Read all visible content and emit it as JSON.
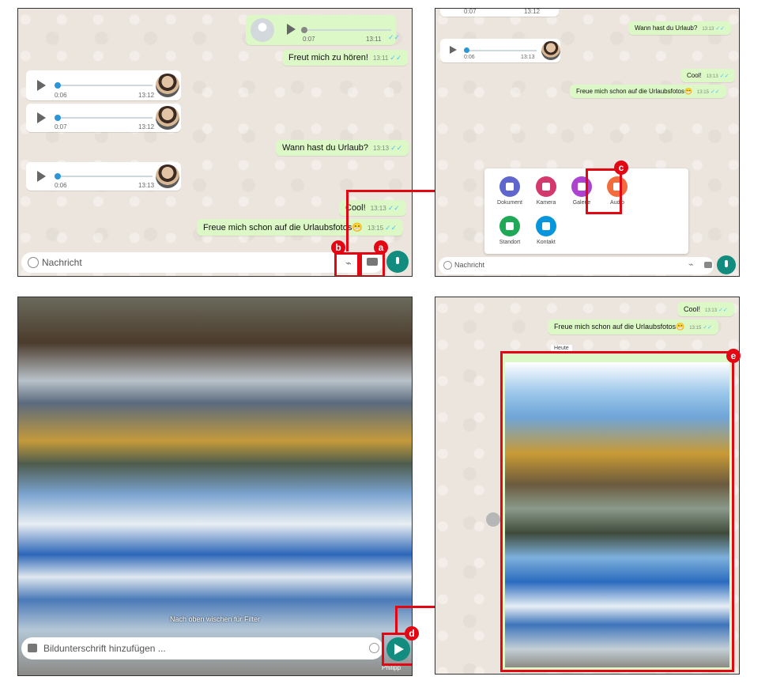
{
  "panel1": {
    "voice_out": {
      "elapsed": "0:07",
      "time": "13:11"
    },
    "msg_hoeren": {
      "text": "Freut mich zu hören!",
      "time": "13:11"
    },
    "voice_in": [
      {
        "elapsed": "0:06",
        "time": "13:12"
      },
      {
        "elapsed": "0:07",
        "time": "13:12"
      },
      {
        "elapsed": "0:06",
        "time": "13:13"
      }
    ],
    "msg_urlaub": {
      "text": "Wann hast du Urlaub?",
      "time": "13:13"
    },
    "msg_cool": {
      "text": "Cool!",
      "time": "13:13"
    },
    "msg_fotos": {
      "text": "Freue mich schon auf die Urlaubsfotos😁",
      "time": "13:15"
    },
    "input_placeholder": "Nachricht",
    "badge_b": "b",
    "badge_a": "a"
  },
  "panel2": {
    "top_times": [
      "0:07",
      "13:12"
    ],
    "msg_urlaub": {
      "text": "Wann hast du Urlaub?",
      "time": "13:13"
    },
    "voice_in": {
      "elapsed": "0:06",
      "time": "13:13"
    },
    "msg_cool": {
      "text": "Cool!",
      "time": "13:13"
    },
    "msg_fotos": {
      "text": "Freue mich schon auf die Urlaubsfotos😁",
      "time": "13:15"
    },
    "attach_menu": [
      {
        "label": "Dokument",
        "color": "#5f66cd"
      },
      {
        "label": "Kamera",
        "color": "#d3396d"
      },
      {
        "label": "Galerie",
        "color": "#ac44cf"
      },
      {
        "label": "Audio",
        "color": "#f26d3d"
      },
      {
        "label": "Standort",
        "color": "#1fa855"
      },
      {
        "label": "Kontakt",
        "color": "#0795dc"
      }
    ],
    "input_placeholder": "Nachricht",
    "badge_c": "c"
  },
  "panel3": {
    "swipe_hint": "Nach oben wischen für Filter",
    "caption_placeholder": "Bildunterschrift hinzufügen ...",
    "recipient": "Philipp",
    "badge_d": "d"
  },
  "panel4": {
    "msg_cool": {
      "text": "Cool!",
      "time": "13:13"
    },
    "msg_fotos": {
      "text": "Freue mich schon auf die Urlaubsfotos😁",
      "time": "13:15"
    },
    "date_chip": "Heute",
    "badge_e": "e"
  },
  "colors": {
    "accent": "#e30613",
    "whatsapp_green": "#128c7e",
    "bubble_out": "#dcf8c6"
  }
}
